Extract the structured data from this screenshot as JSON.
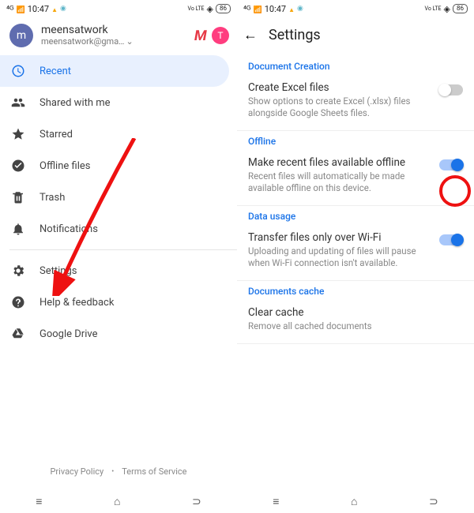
{
  "status": {
    "time": "10:47",
    "lte": "Vo LTE",
    "battery": "86"
  },
  "profile": {
    "initial": "m",
    "name": "meensatwork",
    "email": "meensatwork@gma…",
    "badge": "T"
  },
  "nav": {
    "recent": "Recent",
    "shared": "Shared with me",
    "starred": "Starred",
    "offline": "Offline files",
    "trash": "Trash",
    "notifications": "Notifications",
    "settings": "Settings",
    "help": "Help & feedback",
    "drive": "Google Drive"
  },
  "footer": {
    "privacy": "Privacy Policy",
    "terms": "Terms of Service"
  },
  "settings": {
    "title": "Settings",
    "section1": "Document Creation",
    "excel_t": "Create Excel files",
    "excel_s": "Show options to create Excel (.xlsx) files alongside Google Sheets files.",
    "section2": "Offline",
    "offline_t": "Make recent files available offline",
    "offline_s": "Recent files will automatically be made available offline on this device.",
    "section3": "Data usage",
    "wifi_t": "Transfer files only over Wi-Fi",
    "wifi_s": "Uploading and updating of files will pause when Wi-Fi connection isn't available.",
    "section4": "Documents cache",
    "cache_t": "Clear cache",
    "cache_s": "Remove all cached documents"
  }
}
